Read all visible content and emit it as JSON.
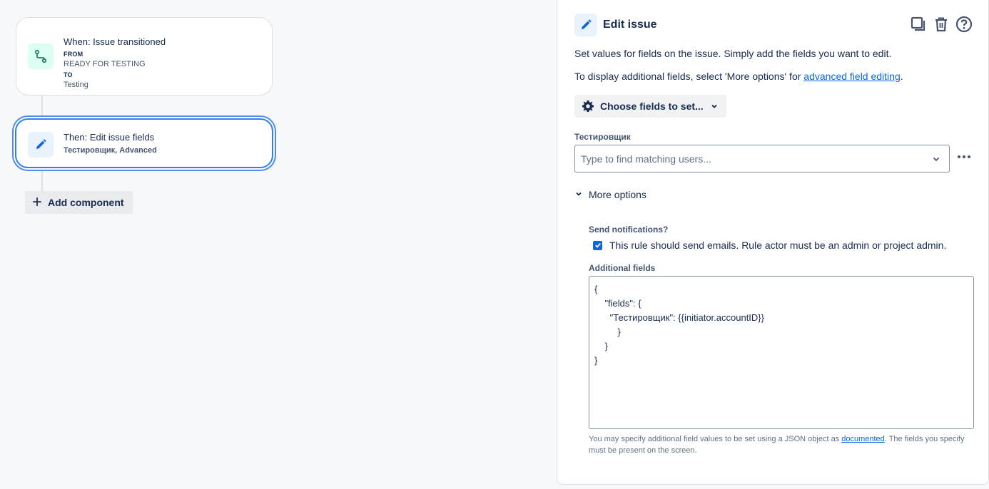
{
  "trigger": {
    "title": "When: Issue transitioned",
    "from_label": "FROM",
    "from_value": "READY FOR TESTING",
    "to_label": "TO",
    "to_value": "Testing",
    "icon": "transition-icon"
  },
  "action": {
    "title": "Then: Edit issue fields",
    "subtitle": "Тестировщик, Advanced",
    "icon": "pencil-icon"
  },
  "add_component_label": "Add component",
  "panel": {
    "title": "Edit issue",
    "description": "Set values for fields on the issue. Simply add the fields you want to edit.",
    "more_info_prefix": "To display additional fields, select 'More options' for ",
    "more_info_link": "advanced field editing",
    "more_info_suffix": ".",
    "choose_fields_label": "Choose fields to set...",
    "field_label": "Тестировщик",
    "user_placeholder": "Type to find matching users...",
    "more_options_label": "More options",
    "send_notifications_label": "Send notifications?",
    "send_notifications_text": "This rule should send emails. Rule actor must be an admin or project admin.",
    "send_notifications_checked": true,
    "additional_fields_label": "Additional fields",
    "additional_fields_value": "{\n    \"fields\": {\n      \"Тестировщик\": {{initiator.accountID}}\n         }\n    }\n}",
    "help_prefix": "You may specify additional field values to be set using a JSON object as ",
    "help_link": "documented",
    "help_suffix": ". The fields you specify must be present on the screen."
  },
  "colors": {
    "accent": "#0c66e4",
    "trigger_icon": "#1f845a",
    "selected_border": "#2f7ff2"
  }
}
